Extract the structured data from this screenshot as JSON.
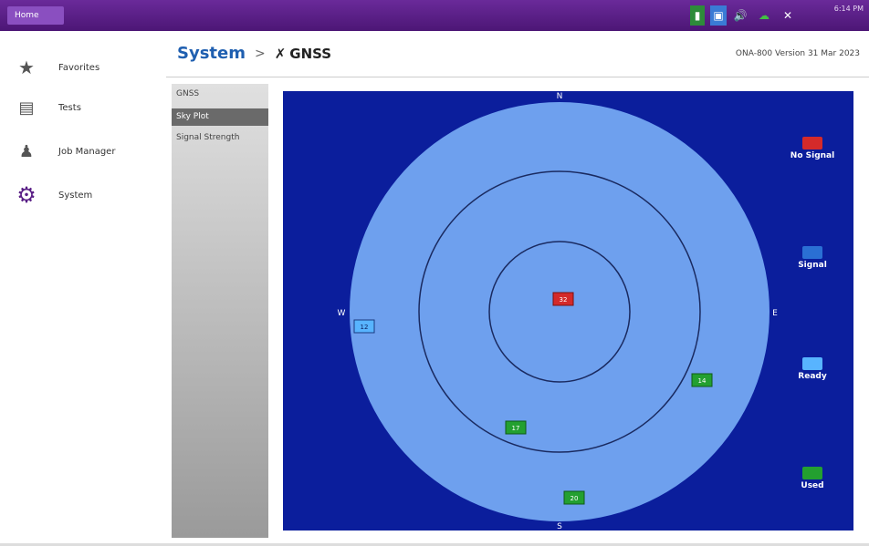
{
  "topbar": {
    "home_label": "Home",
    "time": "6:14 PM"
  },
  "sidebar": {
    "items": [
      {
        "label": "Favorites",
        "icon": "star-icon"
      },
      {
        "label": "Tests",
        "icon": "tests-icon"
      },
      {
        "label": "Job Manager",
        "icon": "job-manager-icon"
      },
      {
        "label": "System",
        "icon": "gear-icon"
      }
    ]
  },
  "header": {
    "breadcrumb_root": "System",
    "breadcrumb_sep": ">",
    "breadcrumb_current": "GNSS",
    "version": "ONA-800 Version 31 Mar 2023"
  },
  "subnav": {
    "items": [
      "GNSS",
      "Sky Plot",
      "Signal Strength"
    ],
    "active_index": 1
  },
  "skyplot": {
    "compass": {
      "n": "N",
      "e": "E",
      "s": "S",
      "w": "W"
    },
    "satellites": [
      {
        "id": "32",
        "status": "no-signal"
      },
      {
        "id": "12",
        "status": "ready"
      },
      {
        "id": "14",
        "status": "used"
      },
      {
        "id": "17",
        "status": "used"
      },
      {
        "id": "20",
        "status": "used"
      }
    ],
    "legend": [
      {
        "label": "No Signal",
        "color": "#d42a2a"
      },
      {
        "label": "Signal",
        "color": "#2a6fd4"
      },
      {
        "label": "Ready",
        "color": "#58b4ff"
      },
      {
        "label": "Used",
        "color": "#23a030"
      }
    ]
  },
  "colors": {
    "accent": "#5a1f86",
    "sky_bg": "#0b1e9c",
    "sky_disc": "#6ea0ee"
  }
}
